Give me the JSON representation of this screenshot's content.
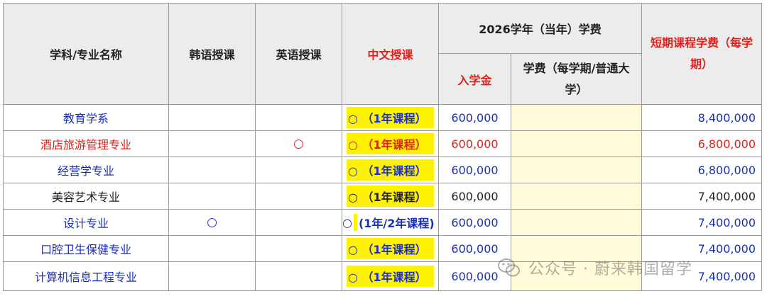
{
  "header": {
    "col_major": "学科/专业名称",
    "col_korean": "韩语授课",
    "col_english": "英语授课",
    "col_chinese": "中文授课",
    "fees_group": "2026学年（当年）学费",
    "col_admission": "入学金",
    "col_tuition": "学费（每学期/普通大学）",
    "col_short_term": "短期课程学费（每学期）"
  },
  "rows": [
    {
      "name": "教育学系",
      "korean": "",
      "english": "",
      "chinese_mark": "○",
      "chinese_course": "（1年课程）",
      "admission": "600,000",
      "tuition": "",
      "short": "8,400,000",
      "color": "blue"
    },
    {
      "name": "酒店旅游管理专业",
      "korean": "",
      "english": "○",
      "chinese_mark": "○",
      "chinese_course": "（1年课程）",
      "admission": "600,000",
      "tuition": "",
      "short": "6,800,000",
      "color": "red"
    },
    {
      "name": "经营学专业",
      "korean": "",
      "english": "",
      "chinese_mark": "○",
      "chinese_course": "（1年课程）",
      "admission": "600,000",
      "tuition": "",
      "short": "6,800,000",
      "color": "blue"
    },
    {
      "name": "美容艺术专业",
      "korean": "",
      "english": "",
      "chinese_mark": "○",
      "chinese_course": "（1年课程）",
      "admission": "600,000",
      "tuition": "",
      "short": "7,400,000",
      "color": "black"
    },
    {
      "name": "设计专业",
      "korean": "○",
      "english": "",
      "chinese_mark": "○",
      "chinese_course": "(1年/2年课程)",
      "admission": "600,000",
      "tuition": "",
      "short": "7,400,000",
      "color": "blue"
    },
    {
      "name": "口腔卫生保健专业",
      "korean": "",
      "english": "",
      "chinese_mark": "○",
      "chinese_course": "（1年课程）",
      "admission": "600,000",
      "tuition": "",
      "short": "7,400,000",
      "color": "blue"
    },
    {
      "name": "计算机信息工程专业",
      "korean": "",
      "english": "",
      "chinese_mark": "○",
      "chinese_course": "（1年课程）",
      "admission": "600,000",
      "tuition": "",
      "short": "7,400,000",
      "color": "blue"
    }
  ],
  "watermark": {
    "text": "公众号 · 蔚来韩国留学",
    "icon": "wechat-icon"
  },
  "colors": {
    "blue": "#1a2fbf",
    "red": "#e0201a",
    "highlight": "#fff200",
    "tuition_fill": "#fffbd8",
    "header_bg": "#ececec"
  }
}
